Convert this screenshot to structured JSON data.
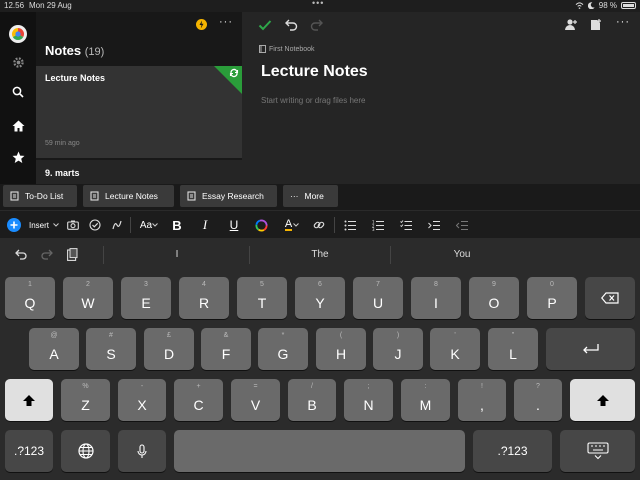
{
  "status_bar": {
    "time": "12.56",
    "date": "Mon 29 Aug",
    "battery": "98 %"
  },
  "notes_list": {
    "title": "Notes",
    "count": "(19)",
    "more": "···",
    "items": [
      {
        "title": "Lecture Notes",
        "meta": "59 min ago"
      },
      {
        "title": "9. marts"
      }
    ]
  },
  "editor": {
    "notebook": "First Notebook",
    "title": "Lecture Notes",
    "placeholder": "Start writing or drag files here",
    "more": "···"
  },
  "tabs": [
    {
      "label": "To-Do List"
    },
    {
      "label": "Lecture Notes"
    },
    {
      "label": "Essay Research"
    },
    {
      "label": "More",
      "prefix": "···"
    }
  ],
  "format_toolbar": {
    "insert_label": "Insert",
    "font_label": "Aa",
    "bold": "B",
    "italic": "I",
    "underline": "U",
    "highlight": "A"
  },
  "keyboard": {
    "suggestions": [
      "I",
      "The",
      "You"
    ],
    "row1": [
      {
        "alt": "1",
        "main": "Q"
      },
      {
        "alt": "2",
        "main": "W"
      },
      {
        "alt": "3",
        "main": "E"
      },
      {
        "alt": "4",
        "main": "R"
      },
      {
        "alt": "5",
        "main": "T"
      },
      {
        "alt": "6",
        "main": "Y"
      },
      {
        "alt": "7",
        "main": "U"
      },
      {
        "alt": "8",
        "main": "I"
      },
      {
        "alt": "9",
        "main": "O"
      },
      {
        "alt": "0",
        "main": "P"
      }
    ],
    "row2": [
      {
        "alt": "@",
        "main": "A"
      },
      {
        "alt": "#",
        "main": "S"
      },
      {
        "alt": "£",
        "main": "D"
      },
      {
        "alt": "&",
        "main": "F"
      },
      {
        "alt": "*",
        "main": "G"
      },
      {
        "alt": "(",
        "main": "H"
      },
      {
        "alt": ")",
        "main": "J"
      },
      {
        "alt": "'",
        "main": "K"
      },
      {
        "alt": "\"",
        "main": "L"
      }
    ],
    "row3": [
      {
        "alt": "%",
        "main": "Z"
      },
      {
        "alt": "-",
        "main": "X"
      },
      {
        "alt": "+",
        "main": "C"
      },
      {
        "alt": "=",
        "main": "V"
      },
      {
        "alt": "/",
        "main": "B"
      },
      {
        "alt": ";",
        "main": "N"
      },
      {
        "alt": ":",
        "main": "M"
      },
      {
        "alt": "!",
        "main": ","
      },
      {
        "alt": "?",
        "main": "."
      }
    ],
    "numbers_label": ".?123"
  },
  "colors": {
    "accent_green": "#2a9d3a",
    "insert_blue": "#1a8cff",
    "lightning": "#f5b400"
  },
  "icons": [
    "gear-icon",
    "search-icon",
    "home-icon",
    "star-icon",
    "check-icon",
    "undo-icon",
    "redo-icon",
    "share-person-icon",
    "notebook-icon",
    "sync-icon",
    "camera-icon",
    "checkbox-icon",
    "pen-icon",
    "color-wheel-icon",
    "link-icon",
    "bullet-list-icon",
    "numbered-list-icon",
    "checklist-icon",
    "indent-icon",
    "outdent-icon",
    "paste-icon",
    "delete-icon",
    "return-icon",
    "shift-icon",
    "globe-icon",
    "microphone-icon",
    "keyboard-dismiss-icon"
  ]
}
